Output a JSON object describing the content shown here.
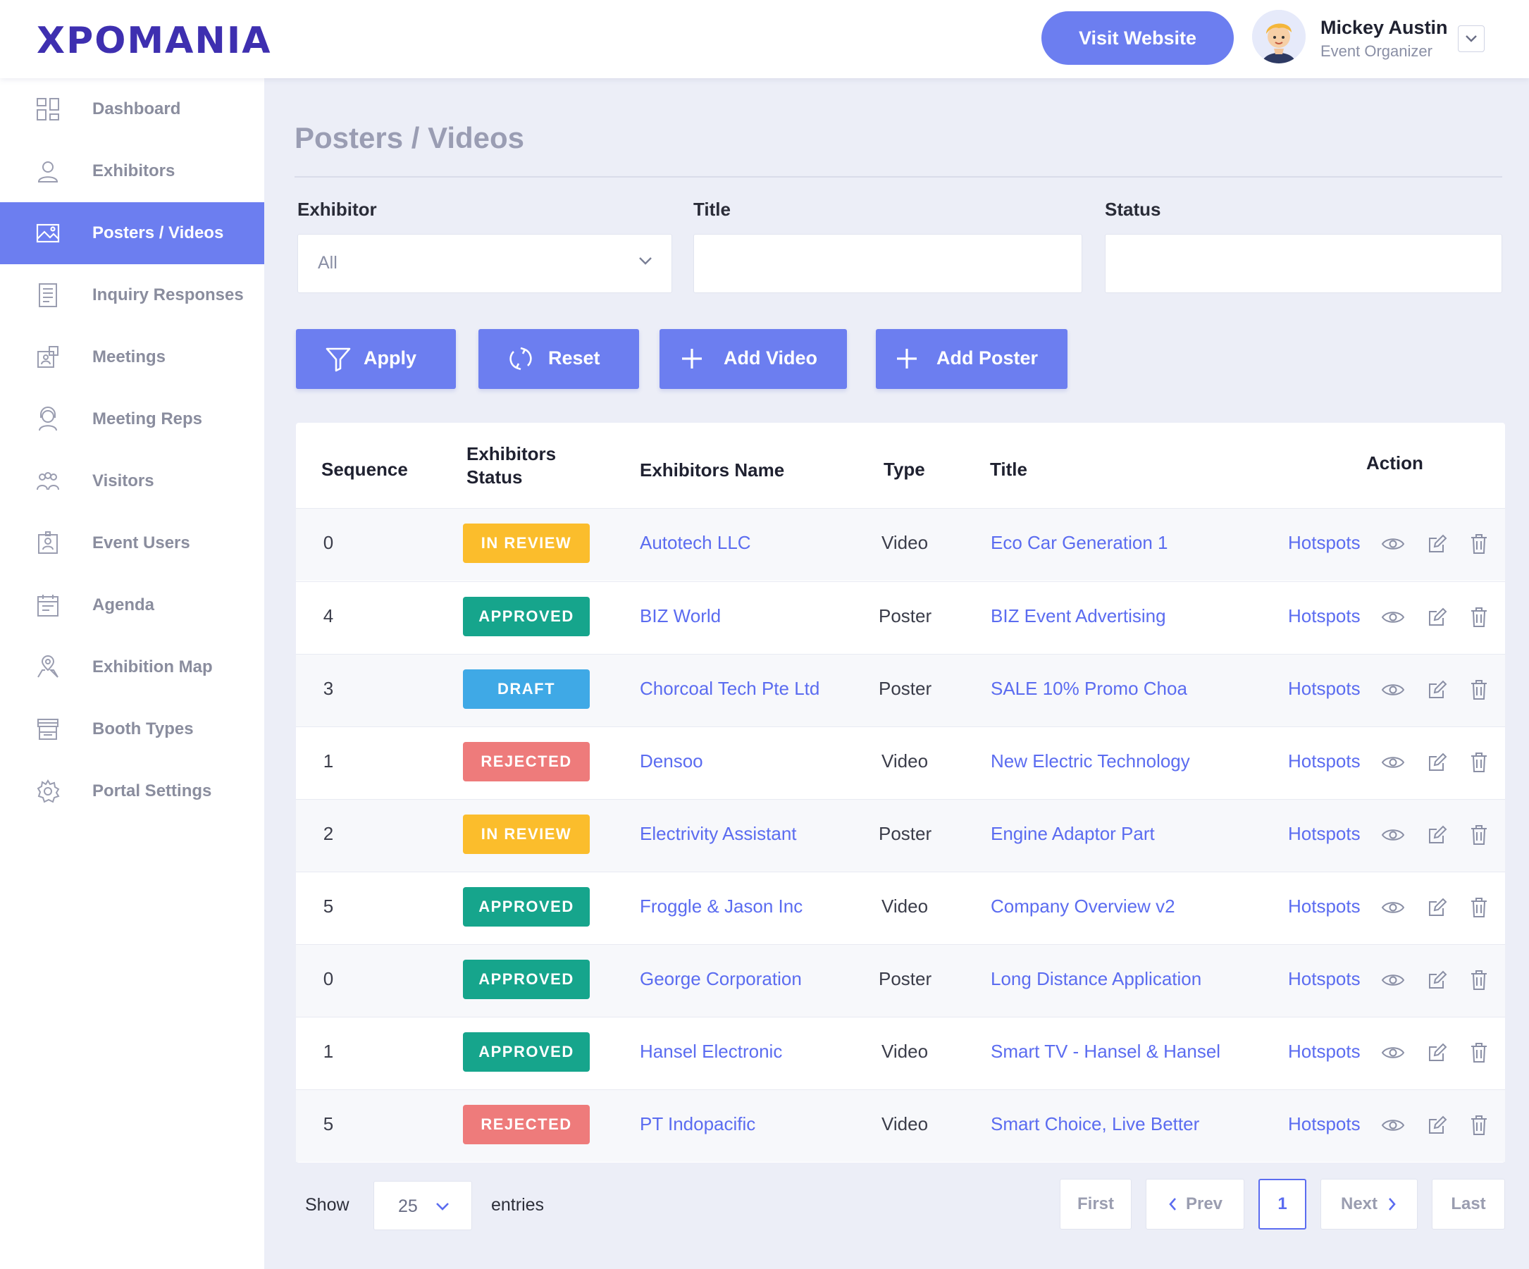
{
  "header": {
    "logo": "XPOMANIA",
    "visit_label": "Visit Website",
    "user_name": "Mickey Austin",
    "user_role": "Event Organizer"
  },
  "sidebar": {
    "items": [
      {
        "label": "Dashboard",
        "icon": "dashboard-icon"
      },
      {
        "label": "Exhibitors",
        "icon": "user-icon"
      },
      {
        "label": "Posters / Videos",
        "icon": "image-icon",
        "active": true
      },
      {
        "label": "Inquiry Responses",
        "icon": "document-icon"
      },
      {
        "label": "Meetings",
        "icon": "meeting-icon"
      },
      {
        "label": "Meeting Reps",
        "icon": "headset-icon"
      },
      {
        "label": "Visitors",
        "icon": "group-icon"
      },
      {
        "label": "Event Users",
        "icon": "badge-icon"
      },
      {
        "label": "Agenda",
        "icon": "calendar-icon"
      },
      {
        "label": "Exhibition Map",
        "icon": "map-pin-icon"
      },
      {
        "label": "Booth Types",
        "icon": "booth-icon"
      },
      {
        "label": "Portal Settings",
        "icon": "gear-icon"
      }
    ]
  },
  "page": {
    "title": "Posters / Videos"
  },
  "filters": {
    "exhibitor_label": "Exhibitor",
    "exhibitor_value": "All",
    "title_label": "Title",
    "title_value": "",
    "status_label": "Status",
    "status_value": ""
  },
  "actions": {
    "apply": "Apply",
    "reset": "Reset",
    "add_video": "Add Video",
    "add_poster": "Add Poster"
  },
  "table": {
    "headers": {
      "sequence": "Sequence",
      "status_line1": "Exhibitors",
      "status_line2": "Status",
      "name": "Exhibitors Name",
      "type": "Type",
      "title": "Title",
      "action": "Action"
    },
    "hotspots_label": "Hotspots",
    "rows": [
      {
        "seq": "0",
        "status": "IN REVIEW",
        "name": "Autotech LLC",
        "type": "Video",
        "title": "Eco Car Generation 1"
      },
      {
        "seq": "4",
        "status": "APPROVED",
        "name": "BIZ World",
        "type": "Poster",
        "title": "BIZ Event Advertising"
      },
      {
        "seq": "3",
        "status": "DRAFT",
        "name": "Chorcoal Tech Pte Ltd",
        "type": "Poster",
        "title": "SALE 10% Promo Choa"
      },
      {
        "seq": "1",
        "status": "REJECTED",
        "name": "Densoo",
        "type": "Video",
        "title": "New Electric Technology"
      },
      {
        "seq": "2",
        "status": "IN REVIEW",
        "name": "Electrivity Assistant",
        "type": "Poster",
        "title": "Engine Adaptor Part"
      },
      {
        "seq": "5",
        "status": "APPROVED",
        "name": "Froggle & Jason Inc",
        "type": "Video",
        "title": "Company Overview v2"
      },
      {
        "seq": "0",
        "status": "APPROVED",
        "name": "George Corporation",
        "type": "Poster",
        "title": "Long Distance Application"
      },
      {
        "seq": "1",
        "status": "APPROVED",
        "name": "Hansel Electronic",
        "type": "Video",
        "title": "Smart TV - Hansel & Hansel"
      },
      {
        "seq": "5",
        "status": "REJECTED",
        "name": "PT Indopacific",
        "type": "Video",
        "title": "Smart Choice, Live Better"
      }
    ]
  },
  "status_colors": {
    "IN REVIEW": "#fbbd2c",
    "APPROVED": "#16a58c",
    "DRAFT": "#3fa9e6",
    "REJECTED": "#ee7b7b"
  },
  "colors": {
    "accent": "#6c7ef0",
    "link": "#5b6cf0",
    "brand": "#3e2fb0"
  },
  "pagination": {
    "show_label": "Show",
    "entries_value": "25",
    "entries_label": "entries",
    "first": "First",
    "prev": "Prev",
    "current": "1",
    "next": "Next",
    "last": "Last"
  }
}
